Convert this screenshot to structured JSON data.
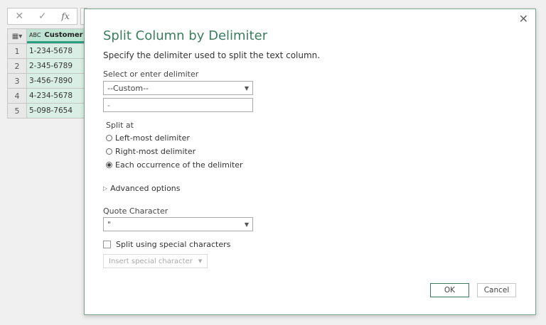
{
  "formula_bar": {
    "cancel_icon": "✕",
    "confirm_icon": "✓",
    "fx_label": "fx"
  },
  "grid": {
    "column_header": "Customer ID",
    "type_icon": "ABC",
    "rows": [
      {
        "n": "1",
        "v": "1-234-5678"
      },
      {
        "n": "2",
        "v": "2-345-6789"
      },
      {
        "n": "3",
        "v": "3-456-7890"
      },
      {
        "n": "4",
        "v": "4-234-5678"
      },
      {
        "n": "5",
        "v": "5-098-7654"
      }
    ]
  },
  "dialog": {
    "title": "Split Column by Delimiter",
    "subtitle": "Specify the delimiter used to split the text column.",
    "delimiter_label": "Select or enter delimiter",
    "delimiter_selected": "--Custom--",
    "custom_value": "-",
    "split_at_label": "Split at",
    "options": [
      "Left-most delimiter",
      "Right-most delimiter",
      "Each occurrence of the delimiter"
    ],
    "selected_option": 2,
    "advanced_label": "Advanced options",
    "quote_label": "Quote Character",
    "quote_value": "\"",
    "special_chars_label": "Split using special characters",
    "insert_special_label": "Insert special character",
    "ok_label": "OK",
    "cancel_label": "Cancel"
  }
}
